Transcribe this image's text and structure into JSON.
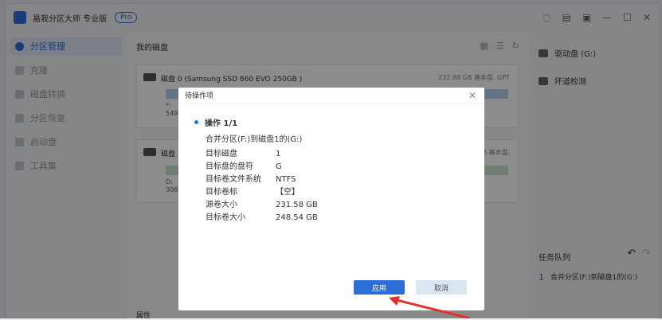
{
  "app": {
    "title": "易我分区大师 专业版",
    "badge": "Pro"
  },
  "sidebar": {
    "items": [
      {
        "label": "分区管理",
        "active": true
      },
      {
        "label": "克隆",
        "active": false
      },
      {
        "label": "磁盘转换",
        "active": false
      },
      {
        "label": "分区恢复",
        "active": false
      },
      {
        "label": "启动盘",
        "active": false
      },
      {
        "label": "工具集",
        "active": false
      }
    ]
  },
  "main": {
    "title": "我的磁盘",
    "disks": [
      {
        "name": "磁盘 0",
        "model": "(Samsung SSD 860 EVO 250GB )",
        "info": "232.88 GB 基本盘, GPT",
        "part_labels": [
          "*:",
          "549"
        ]
      },
      {
        "name": "磁盘",
        "model": "",
        "info": "GB 基本盘,",
        "part_labels": [
          "D:",
          "308."
        ]
      }
    ],
    "properties_label": "属性"
  },
  "right": {
    "items": [
      {
        "label": "驱动盘 (G:)",
        "icon": "drive-icon"
      },
      {
        "label": "坏道检测",
        "icon": "scan-icon"
      }
    ],
    "queue_title": "任务队列",
    "queue_item": {
      "number": "1",
      "text": "合并分区(F:)到磁盘1的(G:)"
    }
  },
  "dialog": {
    "title": "待操作项",
    "operation_title": "操作 1/1",
    "operation_desc": "合并分区(F:)到磁盘1的(G:)",
    "details": [
      {
        "key": "目标磁盘",
        "value": "1"
      },
      {
        "key": "目标盘的盘符",
        "value": "G"
      },
      {
        "key": "目标卷文件系统",
        "value": "NTFS"
      },
      {
        "key": "目标卷标",
        "value": "【空】"
      },
      {
        "key": "源卷大小",
        "value": "231.58 GB"
      },
      {
        "key": "目标卷大小",
        "value": "248.54 GB"
      }
    ],
    "apply_label": "应用",
    "cancel_label": "取消"
  },
  "colors": {
    "accent": "#2b6fd6",
    "arrow": "#e0322b"
  }
}
